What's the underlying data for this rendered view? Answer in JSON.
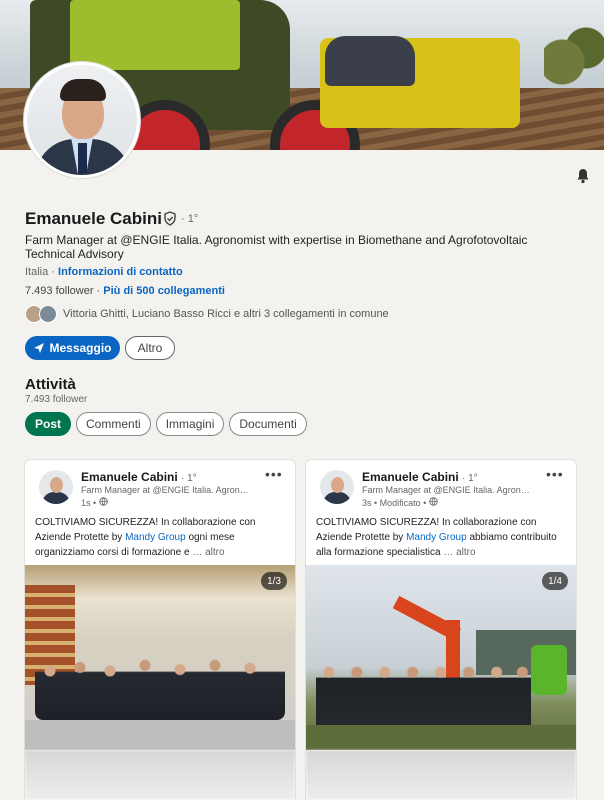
{
  "profile": {
    "name": "Emanuele Cabini",
    "degree": "· 1°",
    "headline": "Farm Manager at @ENGIE Italia. Agronomist with expertise in Biomethane and Agrofotovoltaic Technical Advisory",
    "location": "Italia ·",
    "contact_link": "Informazioni di contatto",
    "followers": "7.493 follower ·",
    "connections_link": "Più di 500 collegamenti",
    "mutual": "Vittoria Ghitti, Luciano Basso Ricci e altri 3 collegamenti in comune"
  },
  "actions": {
    "message_label": "Messaggio",
    "more_label": "Altro"
  },
  "activity": {
    "title": "Attività",
    "followers": "7.493 follower",
    "tabs": [
      "Post",
      "Commenti",
      "Immagini",
      "Documenti"
    ],
    "active_tab": "Post"
  },
  "posts": [
    {
      "author": "Emanuele Cabini",
      "degree": "· 1°",
      "headline": "Farm Manager at @ENGIE Italia. Agronomist with expertise in Biomethane",
      "time": "1s •",
      "text_before": "COLTIVIAMO SICUREZZA! In collaborazione con Aziende Protette by",
      "mention": "Mandy Group",
      "text_after": "ogni mese organizziamo corsi di formazione e",
      "more": "… altro",
      "counter": "1/3"
    },
    {
      "author": "Emanuele Cabini",
      "degree": "· 1°",
      "headline": "Farm Manager at @ENGIE Italia. Agronomist with expertise in Biomethane",
      "time": "3s • Modificato •",
      "text_before": "COLTIVIAMO SICUREZZA! In collaborazione con Aziende Protette by",
      "mention": "Mandy Group",
      "text_after": "abbiamo contribuito alla formazione specialistica",
      "more": "… altro",
      "counter": "1/4"
    }
  ],
  "icons": {
    "bell": "bell-icon",
    "verified": "verified-shield-icon",
    "send": "paper-plane-icon",
    "globe": "globe-icon",
    "more": "ellipsis-icon"
  },
  "colors": {
    "primary": "#0a66c2",
    "active_pill": "#01754f",
    "background": "#f4f2ee"
  }
}
